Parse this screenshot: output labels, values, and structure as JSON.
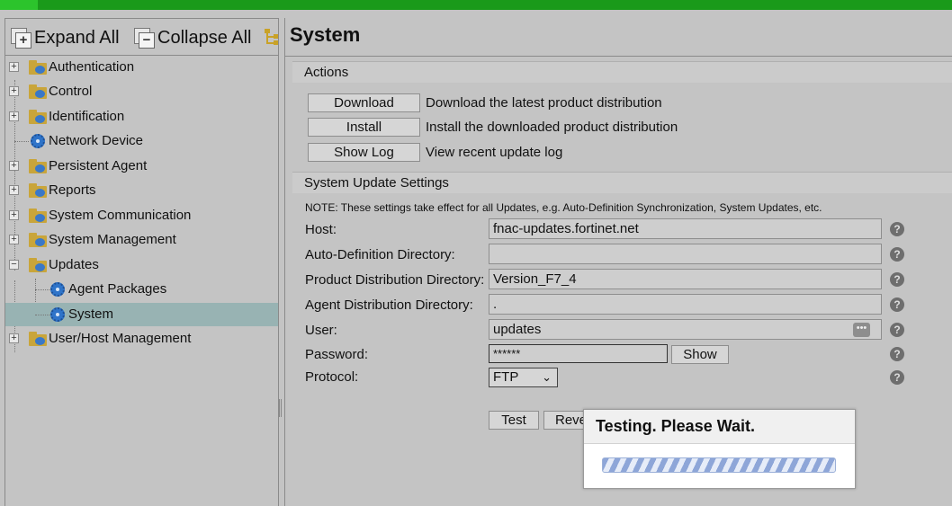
{
  "colors": {
    "top_bar": "#1a9a1a",
    "selection": "#98b3b3",
    "background": "#c4c4c4"
  },
  "toolbar": {
    "expand_all": "Expand All",
    "collapse_all": "Collapse All"
  },
  "tree": {
    "items": [
      {
        "label": "Authentication",
        "icon": "folder-icon",
        "expandable": true
      },
      {
        "label": "Control",
        "icon": "folder-icon",
        "expandable": true
      },
      {
        "label": "Identification",
        "icon": "folder-icon",
        "expandable": true
      },
      {
        "label": "Network Device",
        "icon": "gear-icon",
        "expandable": false
      },
      {
        "label": "Persistent Agent",
        "icon": "folder-icon",
        "expandable": true
      },
      {
        "label": "Reports",
        "icon": "folder-icon",
        "expandable": true
      },
      {
        "label": "System Communication",
        "icon": "folder-icon",
        "expandable": true
      },
      {
        "label": "System Management",
        "icon": "folder-icon",
        "expandable": true
      },
      {
        "label": "Updates",
        "icon": "folder-icon",
        "expanded": true
      },
      {
        "label": "Agent Packages",
        "icon": "gear-icon",
        "child": true
      },
      {
        "label": "System",
        "icon": "gear-icon",
        "child": true,
        "selected": true
      },
      {
        "label": "User/Host Management",
        "icon": "folder-icon",
        "expandable": true
      }
    ]
  },
  "page": {
    "title": "System"
  },
  "actions": {
    "heading": "Actions",
    "rows": [
      {
        "button": "Download",
        "description": "Download the latest product distribution"
      },
      {
        "button": "Install",
        "description": "Install the downloaded product distribution"
      },
      {
        "button": "Show Log",
        "description": "View recent update log"
      }
    ]
  },
  "settings": {
    "heading": "System Update Settings",
    "note": "NOTE: These settings take effect for all Updates, e.g. Auto-Definition Synchronization, System Updates, etc.",
    "host": {
      "label": "Host:",
      "value": "fnac-updates.fortinet.net"
    },
    "auto_def_dir": {
      "label": "Auto-Definition Directory:",
      "value": ""
    },
    "product_dist_dir": {
      "label": "Product Distribution Directory:",
      "value": "Version_F7_4"
    },
    "agent_dist_dir": {
      "label": "Agent Distribution Directory:",
      "value": "."
    },
    "user": {
      "label": "User:",
      "value": "updates"
    },
    "password": {
      "label": "Password:",
      "value": "******",
      "show_button": "Show"
    },
    "protocol": {
      "label": "Protocol:",
      "value": "FTP"
    },
    "help_glyph": "?",
    "more_glyph": "•••"
  },
  "buttons": {
    "test": "Test",
    "revert": "Reve"
  },
  "modal": {
    "title": "Testing. Please Wait."
  }
}
